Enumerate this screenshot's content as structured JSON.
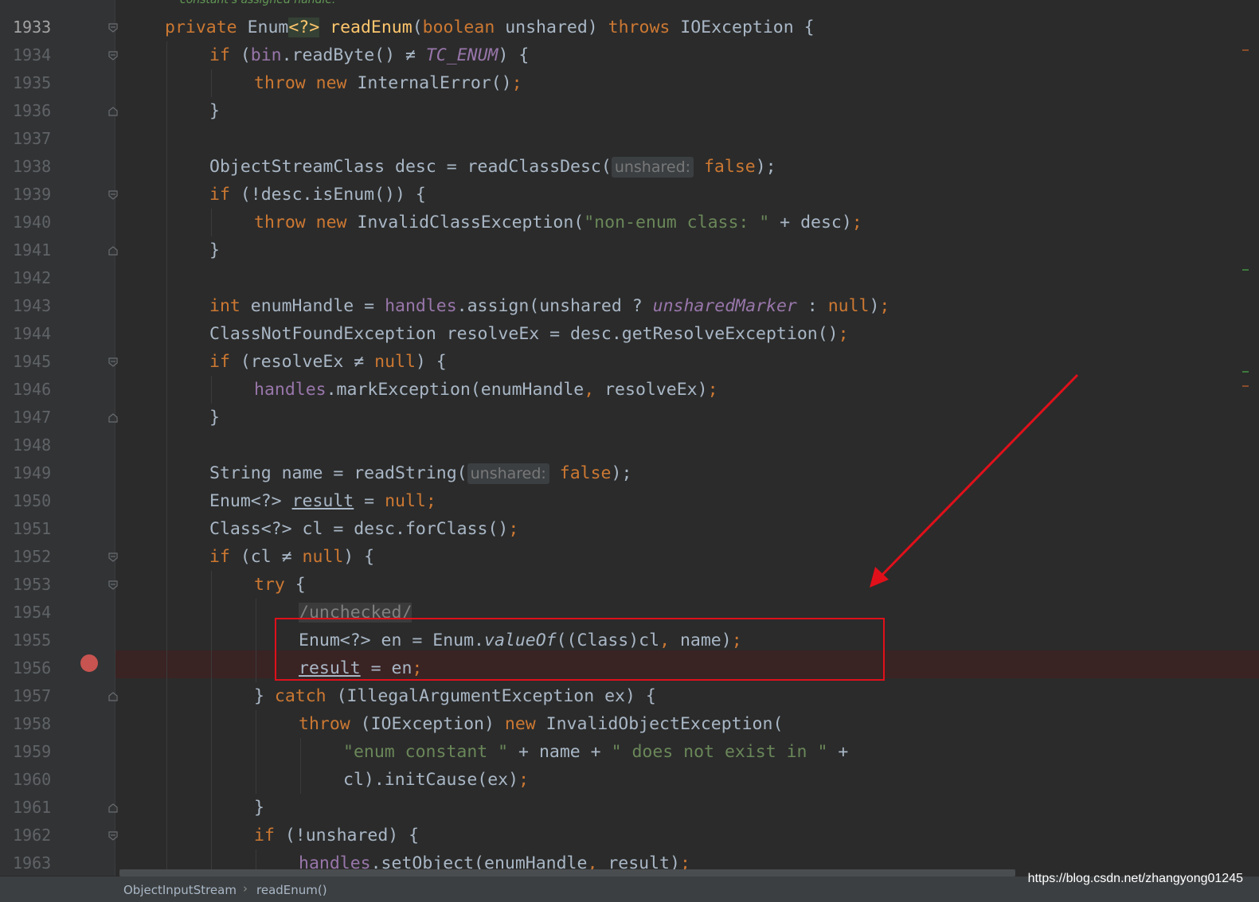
{
  "top_hint": "constant's assigned handle.",
  "line_numbers": [
    "1933",
    "1934",
    "1935",
    "1936",
    "1937",
    "1938",
    "1939",
    "1940",
    "1941",
    "1942",
    "1943",
    "1944",
    "1945",
    "1946",
    "1947",
    "1948",
    "1949",
    "1950",
    "1951",
    "1952",
    "1953",
    "1954",
    "1955",
    "1956",
    "1957",
    "1958",
    "1959",
    "1960",
    "1961",
    "1962",
    "1963"
  ],
  "code": {
    "l1933": [
      "private ",
      "Enum",
      "<?>",
      " ",
      "readEnum",
      "(",
      "boolean ",
      "unshared) ",
      "throws ",
      "IOException {"
    ],
    "l1934": [
      "if ",
      "(",
      "bin",
      ".readByte() ≠ ",
      "TC_ENUM",
      ") {"
    ],
    "l1935": [
      "throw new ",
      "InternalError()",
      ";"
    ],
    "l1936": [
      "}"
    ],
    "l1938": [
      "ObjectStreamClass desc = readClassDesc(",
      "unshared:",
      " false",
      ");"
    ],
    "l1939": [
      "if ",
      "(!desc.isEnum()) {"
    ],
    "l1940": [
      "throw new ",
      "InvalidClassException(",
      "\"non-enum class: \"",
      " + desc)",
      ";"
    ],
    "l1941": [
      "}"
    ],
    "l1943": [
      "int ",
      "enumHandle = ",
      "handles",
      ".assign(unshared ? ",
      "unsharedMarker",
      " : ",
      "null",
      ")",
      ";"
    ],
    "l1944": [
      "ClassNotFoundException resolveEx = desc.getResolveException()",
      ";"
    ],
    "l1945": [
      "if ",
      "(resolveEx ≠ ",
      "null",
      ") {"
    ],
    "l1946": [
      "handles",
      ".markException(enumHandle",
      ", ",
      "resolveEx)",
      ";"
    ],
    "l1947": [
      "}"
    ],
    "l1949": [
      "String name = readString(",
      "unshared:",
      " false",
      ");"
    ],
    "l1950": [
      "Enum<?> ",
      "result",
      " = ",
      "null",
      ";"
    ],
    "l1951": [
      "Class<?> cl = desc.forClass()",
      ";"
    ],
    "l1952": [
      "if ",
      "(cl ≠ ",
      "null",
      ") {"
    ],
    "l1953": [
      "try ",
      "{"
    ],
    "l1954": [
      "/unchecked/"
    ],
    "l1955": [
      "Enum<?> en = Enum.",
      "valueOf",
      "((Class)cl",
      ", ",
      "name)",
      ";"
    ],
    "l1956": [
      "result",
      " = en",
      ";"
    ],
    "l1957": [
      "} ",
      "catch ",
      "(IllegalArgumentException ex) {"
    ],
    "l1958": [
      "throw ",
      "(IOException) ",
      "new ",
      "InvalidObjectException("
    ],
    "l1959": [
      "\"enum constant \"",
      " + name + ",
      "\" does not exist in \"",
      " +"
    ],
    "l1960": [
      "cl).initCause(ex)",
      ";"
    ],
    "l1961": [
      "}"
    ],
    "l1962": [
      "if ",
      "(!unshared) {"
    ],
    "l1963": [
      "handles",
      ".setObject(enumHandle",
      ", ",
      "result",
      ")",
      ";"
    ]
  },
  "breadcrumb": [
    "ObjectInputStream",
    "readEnum()"
  ],
  "watermark": "https://blog.csdn.net/zhangyong01245",
  "colors": {
    "background": "#2b2b2b",
    "keyword": "#cc7832",
    "field": "#9876aa",
    "method": "#ffc66d",
    "string": "#6a8759",
    "text": "#a9b7c6",
    "breakpoint": "#c75450",
    "annotation_red": "#e0101a"
  }
}
